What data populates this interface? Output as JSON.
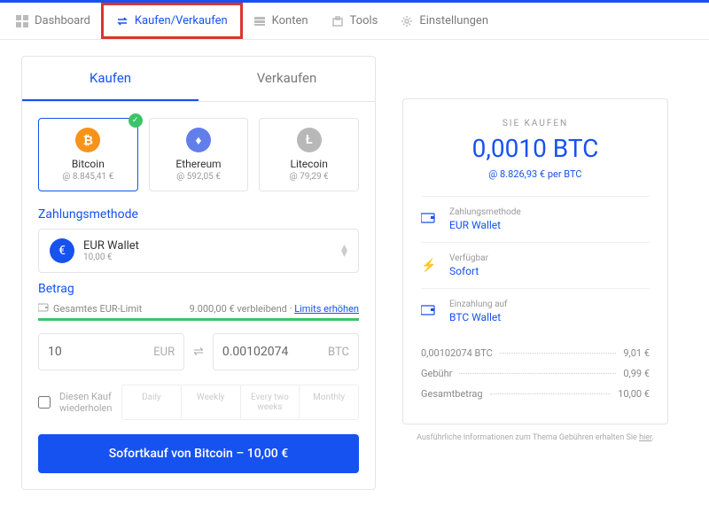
{
  "nav": {
    "dashboard": "Dashboard",
    "buysell": "Kaufen/Verkaufen",
    "accounts": "Konten",
    "tools": "Tools",
    "settings": "Einstellungen"
  },
  "tabs": {
    "buy": "Kaufen",
    "sell": "Verkaufen"
  },
  "coins": {
    "btc": {
      "name": "Bitcoin",
      "price": "@ 8.845,41 €"
    },
    "eth": {
      "name": "Ethereum",
      "price": "@ 592,05 €"
    },
    "ltc": {
      "name": "Litecoin",
      "price": "@ 79,29 €"
    }
  },
  "payment": {
    "label": "Zahlungsmethode",
    "wallet": "EUR Wallet",
    "balance": "10,00 €"
  },
  "amount": {
    "label": "Betrag",
    "limit_label": "Gesamtes EUR-Limit",
    "limit_remaining": "9.000,00 € verbleibend",
    "limit_link": "Limits erhöhen",
    "eur_value": "10",
    "eur": "EUR",
    "btc_value": "0.00102074",
    "btc": "BTC"
  },
  "repeat": {
    "label": "Diesen Kauf wiederholen",
    "daily": "Daily",
    "weekly": "Weekly",
    "biweekly": "Every two weeks",
    "monthly": "Monthly"
  },
  "buy_button": "Sofortkauf von Bitcoin – 10,00 €",
  "summary": {
    "title": "SIE KAUFEN",
    "amount": "0,0010 BTC",
    "rate": "@ 8.826,93 € per BTC",
    "payment_lbl": "Zahlungsmethode",
    "payment_val": "EUR Wallet",
    "avail_lbl": "Verfügbar",
    "avail_val": "Sofort",
    "deposit_lbl": "Einzahlung auf",
    "deposit_val": "BTC Wallet",
    "row1_lbl": "0,00102074 BTC",
    "row1_val": "9,01 €",
    "row2_lbl": "Gebühr",
    "row2_val": "0,99 €",
    "row3_lbl": "Gesamtbetrag",
    "row3_val": "10,00 €",
    "footnote_prefix": "Ausführliche Informationen zum Thema Gebühren erhalten Sie ",
    "footnote_link": "hier"
  }
}
